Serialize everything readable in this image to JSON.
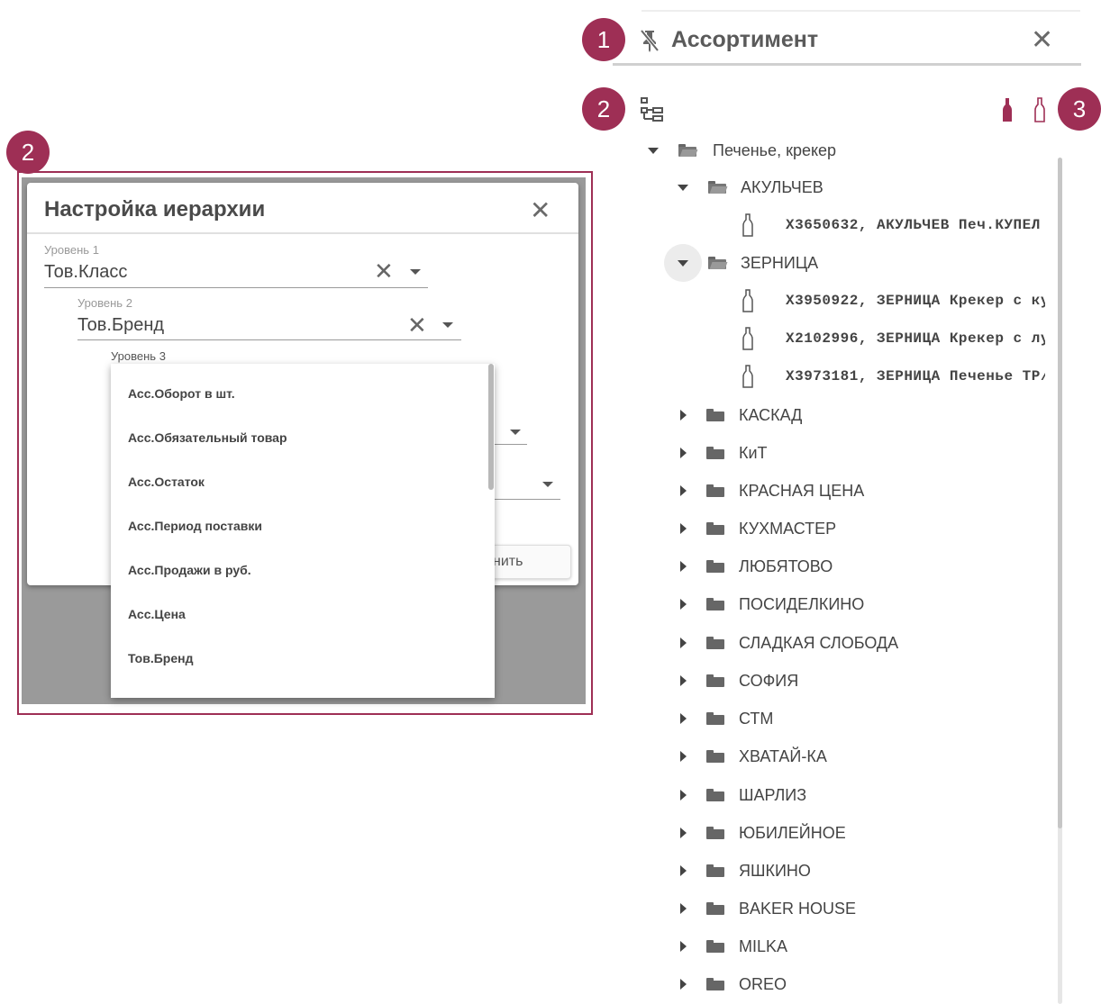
{
  "callouts": [
    "1",
    "2",
    "3",
    "2"
  ],
  "panel": {
    "title": "Ассортимент",
    "pin_icon": "pin-off-icon",
    "close_icon": "close-icon",
    "hierarchy_icon": "hierarchy-settings-icon",
    "filled_bottle_icon": "bottle-filled-icon",
    "outline_bottle_icon": "bottle-outline-icon",
    "accent_color": "#9e2f55"
  },
  "tree": {
    "root": "Печенье, крекер",
    "groups": [
      {
        "label": "АКУЛЬЧЕВ",
        "expanded": true,
        "items": [
          "X3650632, АКУЛЬЧЕВ Печ.КУПЕЛ"
        ]
      },
      {
        "label": "ЗЕРНИЦА",
        "expanded": true,
        "items": [
          "X3950922, ЗЕРНИЦА Крекер с ку",
          "X2102996, ЗЕРНИЦА Крекер с лу",
          "X3973181, ЗЕРНИЦА Печенье ТР/"
        ]
      },
      {
        "label": "КАСКАД"
      },
      {
        "label": "КиТ"
      },
      {
        "label": "КРАСНАЯ ЦЕНА"
      },
      {
        "label": "КУХМАСТЕР"
      },
      {
        "label": "ЛЮБЯТОВО"
      },
      {
        "label": "ПОСИДЕЛКИНО"
      },
      {
        "label": "СЛАДКАЯ СЛОБОДА"
      },
      {
        "label": "СОФИЯ"
      },
      {
        "label": "СТМ"
      },
      {
        "label": "ХВАТАЙ-КА"
      },
      {
        "label": "ШАРЛИЗ"
      },
      {
        "label": "ЮБИЛЕЙНОЕ"
      },
      {
        "label": "ЯШКИНО"
      },
      {
        "label": "BAKER HOUSE"
      },
      {
        "label": "MILKA"
      },
      {
        "label": "OREO"
      }
    ]
  },
  "dialog": {
    "title": "Настройка иерархии",
    "level1": {
      "label": "Уровень 1",
      "value": "Тов.Класс"
    },
    "level2": {
      "label": "Уровень 2",
      "value": "Тов.Бренд"
    },
    "level3": {
      "label": "Уровень 3"
    },
    "save_partial": "нить",
    "options": [
      "Асс.Оборот в шт.",
      "Асс.Обязательный товар",
      "Асс.Остаток",
      "Асс.Период поставки",
      "Асс.Продажи в руб.",
      "Асс.Цена",
      "Тов.Бренд"
    ]
  }
}
